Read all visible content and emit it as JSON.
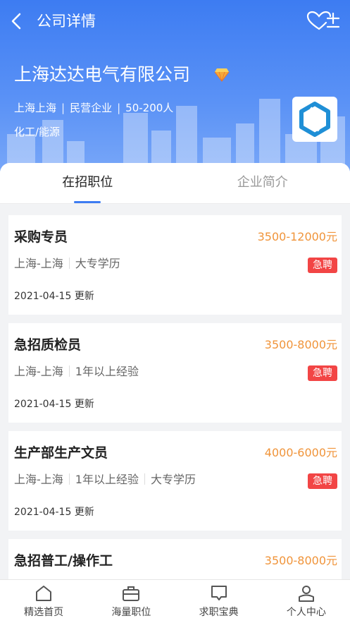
{
  "nav": {
    "title": "公司详情"
  },
  "company": {
    "name": "上海达达电气有限公司",
    "location": "上海上海",
    "type": "民营企业",
    "size": "50-200人",
    "industry": "化工/能源"
  },
  "tabs": [
    {
      "label": "在招职位",
      "active": true
    },
    {
      "label": "企业简介",
      "active": false
    }
  ],
  "jobs": [
    {
      "title": "采购专员",
      "salary": "3500-12000元",
      "location": "上海-上海",
      "tags": [
        "大专学历"
      ],
      "urgent": "急聘",
      "date": "2021-04-15 更新"
    },
    {
      "title": "急招质检员",
      "salary": "3500-8000元",
      "location": "上海-上海",
      "tags": [
        "1年以上经验"
      ],
      "urgent": "急聘",
      "date": "2021-04-15 更新"
    },
    {
      "title": "生产部生产文员",
      "salary": "4000-6000元",
      "location": "上海-上海",
      "tags": [
        "1年以上经验",
        "大专学历"
      ],
      "urgent": "急聘",
      "date": "2021-04-15 更新"
    },
    {
      "title": "急招普工/操作工",
      "salary": "3500-8000元",
      "location": "",
      "tags": [],
      "urgent": "",
      "date": ""
    }
  ],
  "bottom_nav": [
    {
      "label": "精选首页",
      "icon": "home-icon"
    },
    {
      "label": "海量职位",
      "icon": "briefcase-icon"
    },
    {
      "label": "求职宝典",
      "icon": "message-icon"
    },
    {
      "label": "个人中心",
      "icon": "user-icon"
    }
  ],
  "colors": {
    "primary": "#3d7cf2",
    "salary": "#f0943a",
    "urgent": "#f24545"
  }
}
